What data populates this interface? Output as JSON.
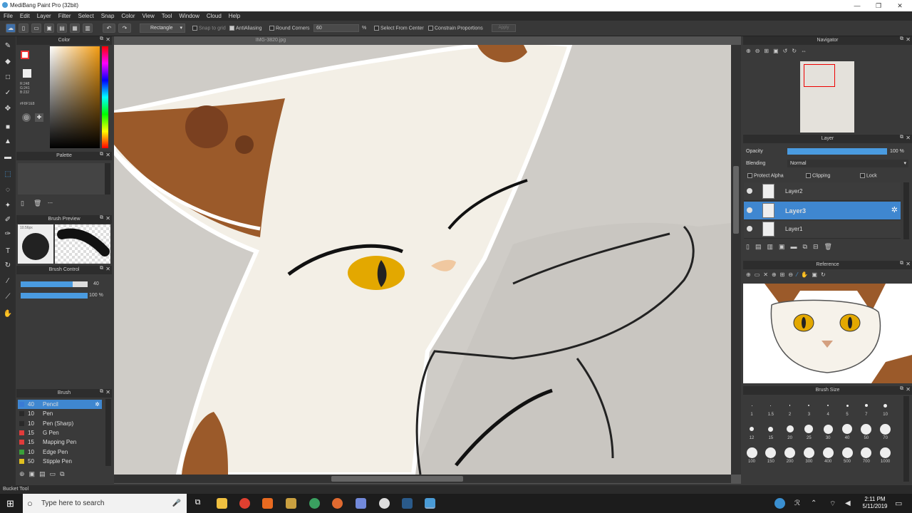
{
  "window": {
    "title": "MediBang Paint Pro (32bit)"
  },
  "menu": [
    "File",
    "Edit",
    "Layer",
    "Filter",
    "Select",
    "Snap",
    "Color",
    "View",
    "Tool",
    "Window",
    "Cloud",
    "Help"
  ],
  "toolbar": {
    "selection_mode": "Rectangle",
    "snap_to_grid": "Snap to grid",
    "antialiasing": "AntiAliasing",
    "round_corners": "Round Corners",
    "round_value": "60",
    "percent": "%",
    "select_from_center": "Select From Center",
    "constrain_proportions": "Constrain Proportions",
    "apply": "Apply"
  },
  "color_panel": {
    "title": "Color",
    "r": "R:248",
    "g": "G:241",
    "b": "B:232",
    "hex": "#F8F1E8"
  },
  "palette_panel": {
    "title": "Palette",
    "dash": "---"
  },
  "brush_preview": {
    "title": "Brush Preview",
    "size": "10.56px"
  },
  "brush_control": {
    "title": "Brush Control",
    "size": "40",
    "opacity": "100 %",
    "size_fill": 0.78,
    "opacity_fill": 1.0
  },
  "brush_panel": {
    "title": "Brush",
    "items": [
      {
        "size": "40",
        "name": "Pencil",
        "color": "#3a7bd5",
        "selected": true
      },
      {
        "size": "10",
        "name": "Pen",
        "color": "#2a2a2a"
      },
      {
        "size": "10",
        "name": "Pen (Sharp)",
        "color": "#2a2a2a"
      },
      {
        "size": "15",
        "name": "G Pen",
        "color": "#e03b3b"
      },
      {
        "size": "15",
        "name": "Mapping Pen",
        "color": "#e03b3b"
      },
      {
        "size": "10",
        "name": "Edge Pen",
        "color": "#3aa03a"
      },
      {
        "size": "50",
        "name": "Stipple Pen",
        "color": "#e0c020"
      }
    ]
  },
  "canvas": {
    "filename": "IMG-3820.jpg"
  },
  "navigator": {
    "title": "Navigator"
  },
  "layer_panel": {
    "title": "Layer",
    "opacity_label": "Opacity",
    "opacity_value": "100 %",
    "blending_label": "Blending",
    "blending_value": "Normal",
    "protect_alpha": "Protect Alpha",
    "clipping": "Clipping",
    "lock": "Lock",
    "layers": [
      {
        "name": "Layer2",
        "selected": false
      },
      {
        "name": "Layer3",
        "selected": true
      },
      {
        "name": "Layer1",
        "selected": false
      }
    ]
  },
  "reference": {
    "title": "Reference"
  },
  "brush_size": {
    "title": "Brush Size",
    "row1": [
      "1",
      "1.5",
      "2",
      "3",
      "4",
      "5",
      "7",
      "10"
    ],
    "row2": [
      "12",
      "15",
      "20",
      "25",
      "30",
      "40",
      "50",
      "70"
    ],
    "row3": [
      "100",
      "150",
      "200",
      "300",
      "400",
      "500",
      "700",
      "1000"
    ]
  },
  "status": {
    "tool": "Bucket Tool"
  },
  "taskbar": {
    "search_placeholder": "Type here to search",
    "time": "2:11 PM",
    "date": "5/11/2019"
  }
}
